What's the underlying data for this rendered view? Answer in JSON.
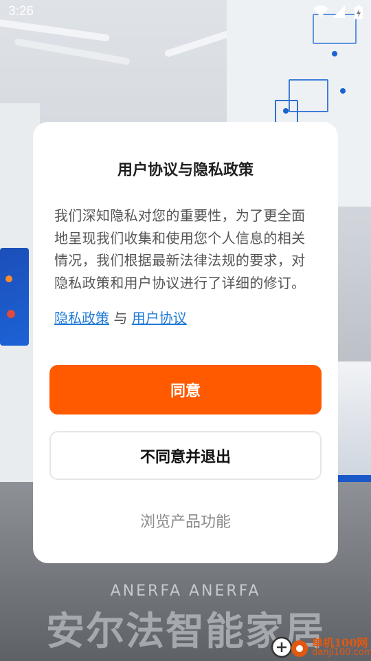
{
  "status_bar": {
    "time": "3:26",
    "icons": [
      "wifi-icon",
      "cell-signal-icon",
      "battery-charging-icon"
    ]
  },
  "background": {
    "brand_en": "ANERFA ANERFA",
    "brand_cn": "安尔法智能家居"
  },
  "dialog": {
    "title": "用户协议与隐私政策",
    "body": "我们深知隐私对您的重要性，为了更全面地呈现我们收集和使用您个人信息的相关情况，我们根据最新法律法规的要求，对隐私政策和用户协议进行了详细的修订。",
    "link_privacy": "隐私政策",
    "link_connector": "与",
    "link_terms": "用户协议",
    "agree_label": "同意",
    "decline_label": "不同意并退出",
    "browse_label": "浏览产品功能"
  },
  "watermark": {
    "line1": "单机100网",
    "line2": "danji100.com"
  },
  "colors": {
    "accent": "#ff5a00",
    "link": "#1f7ad8",
    "watermark": "#e2580f"
  }
}
